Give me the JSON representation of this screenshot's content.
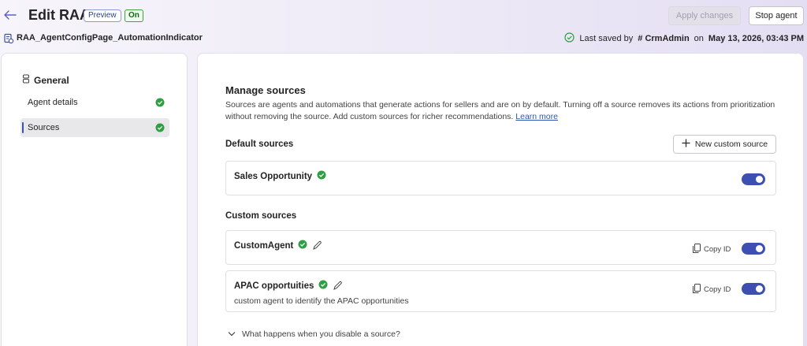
{
  "header": {
    "title": "Edit RAA",
    "preview_badge": "Preview",
    "status_badge": "On",
    "apply_label": "Apply changes",
    "stop_label": "Stop agent"
  },
  "subheader": {
    "record_name": "RAA_AgentConfigPage_AutomationIndicator",
    "saved_prefix": "Last saved by",
    "saved_user": "# CrmAdmin",
    "saved_on": "on",
    "saved_date": "May 13, 2026, 03:43 PM"
  },
  "sidebar": {
    "header": "General",
    "items": [
      {
        "label": "Agent details",
        "complete": true
      },
      {
        "label": "Sources",
        "complete": true,
        "active": true
      }
    ]
  },
  "main": {
    "title": "Manage sources",
    "description": "Sources are agents and automations that generate actions for sellers and are on by default. Turning off a source removes its actions from prioritization without removing the source. Add custom sources for richer recommendations.",
    "learn_more": "Learn more",
    "default_heading": "Default sources",
    "new_source_label": "New custom source",
    "custom_heading": "Custom sources",
    "copy_id_label": "Copy ID",
    "default_sources": [
      {
        "name": "Sales Opportunity",
        "enabled": true
      }
    ],
    "custom_sources": [
      {
        "name": "CustomAgent",
        "description": "",
        "enabled": true
      },
      {
        "name": "APAC opportuities",
        "description": "custom agent to identify the APAC opportunities",
        "enabled": true
      }
    ],
    "faq": "What happens when you disable a source?"
  },
  "colors": {
    "accent": "#3d4fb3",
    "success": "#2ea043"
  }
}
